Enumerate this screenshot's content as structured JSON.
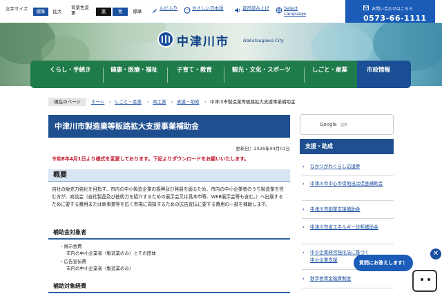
{
  "utility": {
    "text_size_label": "文字サイズ",
    "text_size_standard": "標準",
    "text_size_large": "拡大",
    "bg_color_label": "背景色変更",
    "bg_black": "黒",
    "bg_blue": "青",
    "bg_standard": "標準",
    "ruby_label": "ルビふり",
    "easy_japanese_label": "やさしい日本語",
    "read_aloud_label": "音声読み上げ",
    "language_label": "Select Language"
  },
  "contact": {
    "label": "お問い合わせはこちら",
    "tel": "0573-66-1111"
  },
  "logo": {
    "name": "中津川市",
    "sub": "Nakatsugawa City"
  },
  "nav": [
    {
      "label": "くらし・手続き"
    },
    {
      "label": "健康・医療・福祉"
    },
    {
      "label": "子育て・教育"
    },
    {
      "label": "観光・文化・スポーツ"
    },
    {
      "label": "しごと・産業"
    },
    {
      "label": "市政情報"
    }
  ],
  "breadcrumb": {
    "here_label": "現在のページ",
    "items": [
      "ホーム",
      "しごと・産業",
      "商工業",
      "支援・助成",
      "中津川市製造業等販路拡大支援事業補助金"
    ]
  },
  "page": {
    "title": "中津川市製造業等販路拡大支援事業補助金",
    "updated": "更新日：2026年04月01日",
    "notice": "令和8年4月1日より様式を変更しております。下記よりダウンロードをお願いいたします。",
    "overview_heading": "概要",
    "overview_text": "自社の販売力強化を目指す、市内の中小製造企業の振興及び発展を図るため、市内の中小企業者のうち製造業を営む方が、商談会（自社製品及び技術力を紹介するための展示会又は見本市等、WEB展示会等も含む。）へ出展するために要する費用または新事業等を広く市場に周知するための広告宣伝に要する費用の一部を補助します。",
    "target_heading": "補助金対象者",
    "target_items": [
      {
        "title": "展示会費",
        "detail": "市内の中小企業者（製造業のみ）とその団体"
      },
      {
        "title": "広告宣伝費",
        "detail": "市内の中小企業者（製造業のみ）"
      }
    ],
    "cost_heading": "補助対象経費"
  },
  "sidebar": {
    "search_brand": "Google",
    "search_placeholder": "提供",
    "heading": "支援・助成",
    "items": [
      "なかつがわくらし応援券",
      "中津川市中心市街地出店促進補助金",
      "中津川市創業支援補助金",
      "中津川市省エネルギー診断補助金",
      "中小企業経営強化法に基づく中小企業支援",
      "数学者資金融資制度"
    ]
  },
  "chat": {
    "bubble": "質問にお答えします！",
    "close": "✕"
  },
  "colors": {
    "nav_green": "#1f7b4a",
    "nav_blue": "#1b4f95",
    "title_blue": "#1f4f8f",
    "notice_red": "#c0152a"
  }
}
